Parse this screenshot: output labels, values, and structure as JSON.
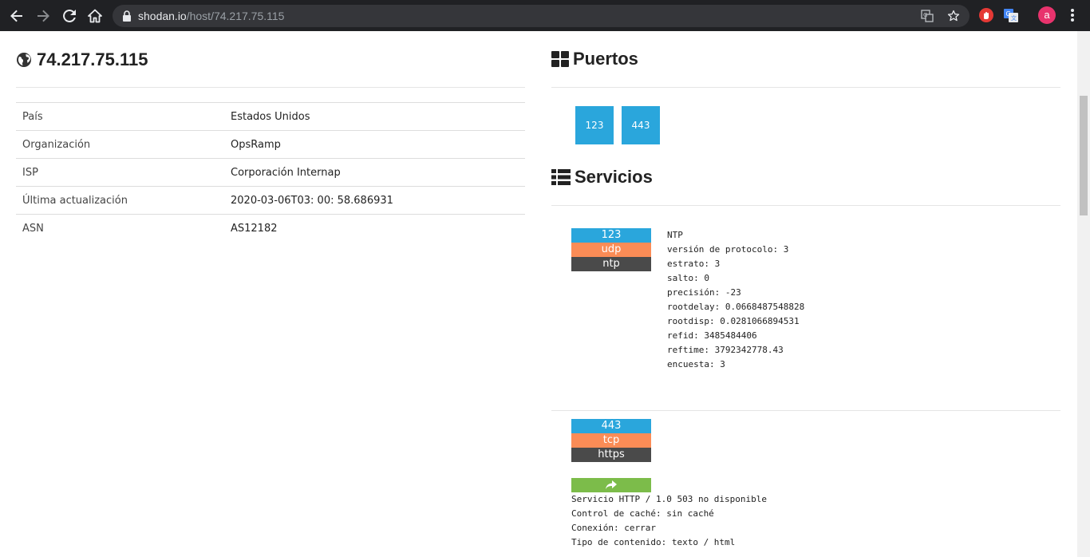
{
  "browser": {
    "url_host": "shodan.io",
    "url_path": "/host/74.217.75.115",
    "avatar_letter": "a",
    "icons": [
      "back-icon",
      "forward-icon",
      "reload-icon",
      "home-icon",
      "lock-icon",
      "translate-icon",
      "star-icon",
      "extension-hand-icon",
      "extension-translate-icon",
      "menu-icon"
    ]
  },
  "host": {
    "ip": "74.217.75.115",
    "rows": [
      {
        "key": "País",
        "value": "Estados Unidos"
      },
      {
        "key": "Organización",
        "value": "OpsRamp"
      },
      {
        "key": "ISP",
        "value": "Corporación Internap"
      },
      {
        "key": "Última actualización",
        "value": "2020-03-06T03: 00: 58.686931"
      },
      {
        "key": "ASN",
        "value": "AS12182"
      }
    ]
  },
  "ports": {
    "title": "Puertos",
    "list": [
      "123",
      "443"
    ]
  },
  "services": {
    "title": "Servicios",
    "items": [
      {
        "port": "123",
        "protocol": "udp",
        "name": "ntp",
        "banner": "NTP\nversión de protocolo: 3\nestrato: 3\nsalto: 0\nprecisión: -23\nrootdelay: 0.0668487548828\nrootdisp: 0.0281066894531\nrefid: 3485484406\nreftime: 3792342778.43\nencuesta: 3"
      },
      {
        "port": "443",
        "protocol": "tcp",
        "name": "https",
        "banner": "Servicio HTTP / 1.0 503 no disponible\nControl de caché: sin caché\nConexión: cerrar\nTipo de contenido: texto / html"
      }
    ]
  },
  "colors": {
    "port_blue": "#2aa6dc",
    "proto_orange": "#fb8c56",
    "name_dark": "#4a4a4a",
    "share_green": "#7cbc4a"
  }
}
